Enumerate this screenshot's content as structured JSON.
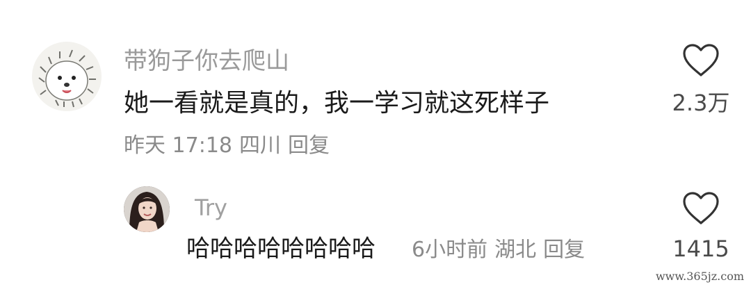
{
  "comment": {
    "username": "带狗子你去爬山",
    "text": "她一看就是真的，我一学习就这死样子",
    "time": "昨天 17:18",
    "location": "四川",
    "reply_label": "回复",
    "like_count": "2.3万",
    "like_icon": "heart-outline-icon",
    "avatar": "hedgehog-avatar"
  },
  "reply": {
    "username": "Try",
    "text": "哈哈哈哈哈哈哈哈",
    "time": "6小时前",
    "location": "湖北",
    "reply_label": "回复",
    "like_count": "1415",
    "like_icon": "heart-outline-icon",
    "avatar": "woman-portrait-avatar"
  },
  "watermark": "www.365jz.com",
  "colors": {
    "username": "#9a9a9a",
    "text": "#1a1a1a",
    "meta": "#8a8a8a",
    "icon": "#333333"
  }
}
